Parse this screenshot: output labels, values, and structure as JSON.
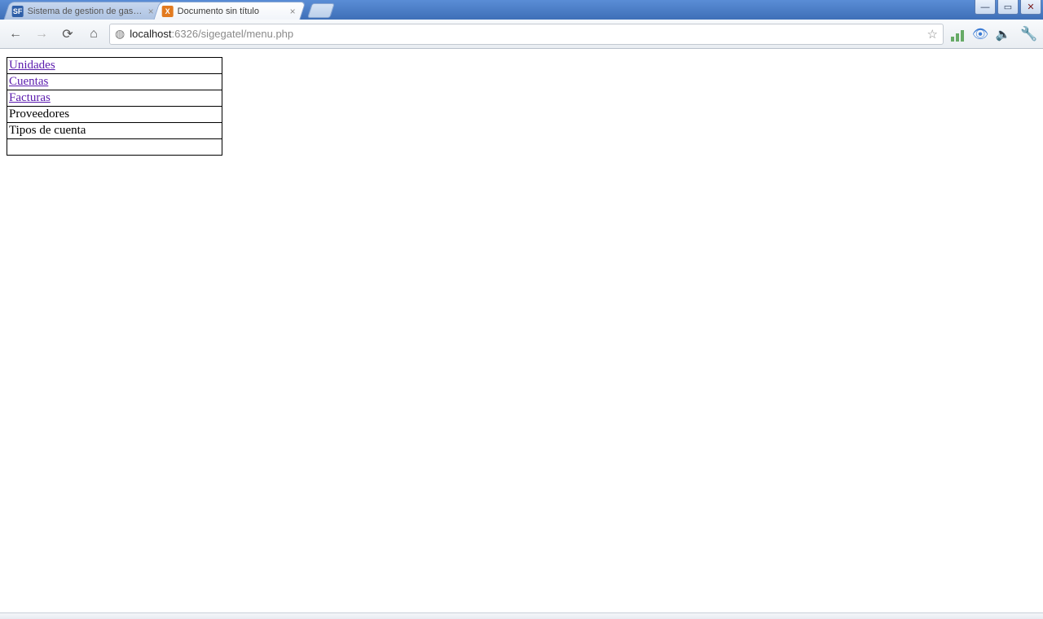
{
  "browser": {
    "tabs": [
      {
        "title": "Sistema de gestion de gastos",
        "active": false,
        "favicon_bg": "#2f5fa8",
        "favicon_text": "SF"
      },
      {
        "title": "Documento sin título",
        "active": true,
        "favicon_bg": "#e27a1f",
        "favicon_text": "X"
      }
    ],
    "url": {
      "host": "localhost",
      "rest": ":6326/sigegatel/menu.php"
    }
  },
  "icons": {
    "back": "←",
    "forward": "→",
    "reload": "⟳",
    "home": "⌂",
    "globe": "◍",
    "star": "☆",
    "wrench": "🔧",
    "eye": "👁",
    "sound": "🔈",
    "minimize": "—",
    "maximize": "▭",
    "close": "✕",
    "tab_close": "×"
  },
  "menu": {
    "items": [
      {
        "label": "Unidades",
        "link": true
      },
      {
        "label": "Cuentas",
        "link": true
      },
      {
        "label": "Facturas",
        "link": true
      },
      {
        "label": "Proveedores",
        "link": false
      },
      {
        "label": "Tipos de cuenta",
        "link": false
      },
      {
        "label": "",
        "link": false
      }
    ]
  }
}
